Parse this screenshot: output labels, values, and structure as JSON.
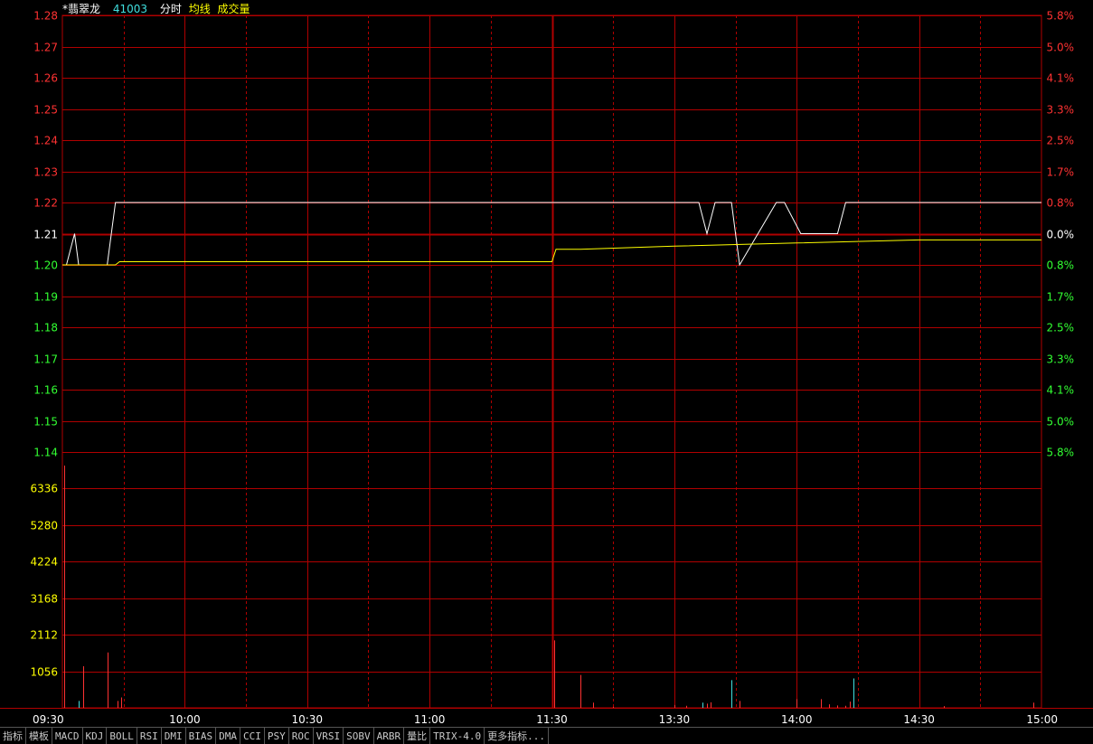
{
  "header": {
    "name": "*翡翠龙",
    "code": "41003",
    "labels": [
      "分时",
      "均线",
      "成交量"
    ]
  },
  "colors": {
    "background": "#000000",
    "grid": "#b00000",
    "price_line": "#ffffff",
    "avg_line": "#ffff00",
    "up": "#ff3232",
    "down": "#32ff32",
    "volume_label": "#ffff00",
    "cyan": "#40e0e0"
  },
  "tabs": [
    "指标",
    "模板",
    "MACD",
    "KDJ",
    "BOLL",
    "RSI",
    "DMI",
    "BIAS",
    "DMA",
    "CCI",
    "PSY",
    "ROC",
    "VRSI",
    "SOBV",
    "ARBR",
    "量比",
    "TRIX-4.0",
    "更多指标..."
  ],
  "chart_data": {
    "type": "line",
    "prev_close": 1.21,
    "price_axis": {
      "ticks": [
        "1.28",
        "1.27",
        "1.26",
        "1.25",
        "1.24",
        "1.23",
        "1.22",
        "1.21",
        "1.20",
        "1.19",
        "1.18",
        "1.17",
        "1.16",
        "1.15",
        "1.14"
      ],
      "pct_ticks": [
        "5.8%",
        "5.0%",
        "4.1%",
        "3.3%",
        "2.5%",
        "1.7%",
        "0.8%",
        "0.0%",
        "0.8%",
        "1.7%",
        "2.5%",
        "3.3%",
        "4.1%",
        "5.0%",
        "5.8%"
      ],
      "range": [
        1.14,
        1.28
      ]
    },
    "volume_axis": {
      "ticks": [
        "6336",
        "5280",
        "4224",
        "3168",
        "2112",
        "1056"
      ],
      "range": [
        0,
        7392
      ]
    },
    "time_axis": {
      "labels": [
        "09:30",
        "10:00",
        "10:30",
        "11:00",
        "11:30",
        "13:30",
        "14:00",
        "14:30",
        "15:00"
      ],
      "range_minutes": [
        0,
        240
      ]
    },
    "series": [
      {
        "key": "price",
        "x": [
          0,
          1,
          3,
          4,
          11,
          13,
          156,
          158,
          160,
          164,
          166,
          175,
          177,
          181,
          190,
          192,
          200
        ],
        "values": [
          1.2,
          1.2,
          1.21,
          1.2,
          1.2,
          1.22,
          1.22,
          1.21,
          1.22,
          1.22,
          1.2,
          1.22,
          1.22,
          1.21,
          1.21,
          1.22,
          1.22
        ],
        "extra": [
          [
            200,
            1.22
          ],
          [
            240,
            1.22
          ]
        ]
      },
      {
        "key": "avg",
        "x": [
          0,
          13,
          14,
          100,
          120,
          121,
          127,
          150,
          180,
          210,
          240
        ],
        "values": [
          1.2,
          1.2,
          1.201,
          1.201,
          1.201,
          1.205,
          1.205,
          1.206,
          1.207,
          1.208,
          1.208
        ]
      }
    ],
    "volume": [
      {
        "x": 0.5,
        "v": 7000,
        "c": "up"
      },
      {
        "x": 4,
        "v": 200,
        "c": "cyan"
      },
      {
        "x": 5,
        "v": 1200,
        "c": "up"
      },
      {
        "x": 11,
        "v": 1600,
        "c": "up"
      },
      {
        "x": 13.5,
        "v": 200,
        "c": "up"
      },
      {
        "x": 14.5,
        "v": 300,
        "c": "up"
      },
      {
        "x": 120.5,
        "v": 1950,
        "c": "up"
      },
      {
        "x": 127,
        "v": 950,
        "c": "up"
      },
      {
        "x": 130,
        "v": 150,
        "c": "up"
      },
      {
        "x": 135,
        "v": 30,
        "c": "up"
      },
      {
        "x": 150,
        "v": 80,
        "c": "up"
      },
      {
        "x": 153,
        "v": 60,
        "c": "up"
      },
      {
        "x": 157,
        "v": 150,
        "c": "cyan"
      },
      {
        "x": 158,
        "v": 120,
        "c": "up"
      },
      {
        "x": 159,
        "v": 160,
        "c": "up"
      },
      {
        "x": 164,
        "v": 800,
        "c": "cyan"
      },
      {
        "x": 166,
        "v": 200,
        "c": "up"
      },
      {
        "x": 180,
        "v": 250,
        "c": "up"
      },
      {
        "x": 186,
        "v": 250,
        "c": "up"
      },
      {
        "x": 188,
        "v": 100,
        "c": "up"
      },
      {
        "x": 190,
        "v": 70,
        "c": "up"
      },
      {
        "x": 192,
        "v": 60,
        "c": "up"
      },
      {
        "x": 193,
        "v": 180,
        "c": "up"
      },
      {
        "x": 194,
        "v": 850,
        "c": "cyan"
      },
      {
        "x": 216,
        "v": 50,
        "c": "up"
      },
      {
        "x": 238,
        "v": 150,
        "c": "up"
      }
    ]
  }
}
